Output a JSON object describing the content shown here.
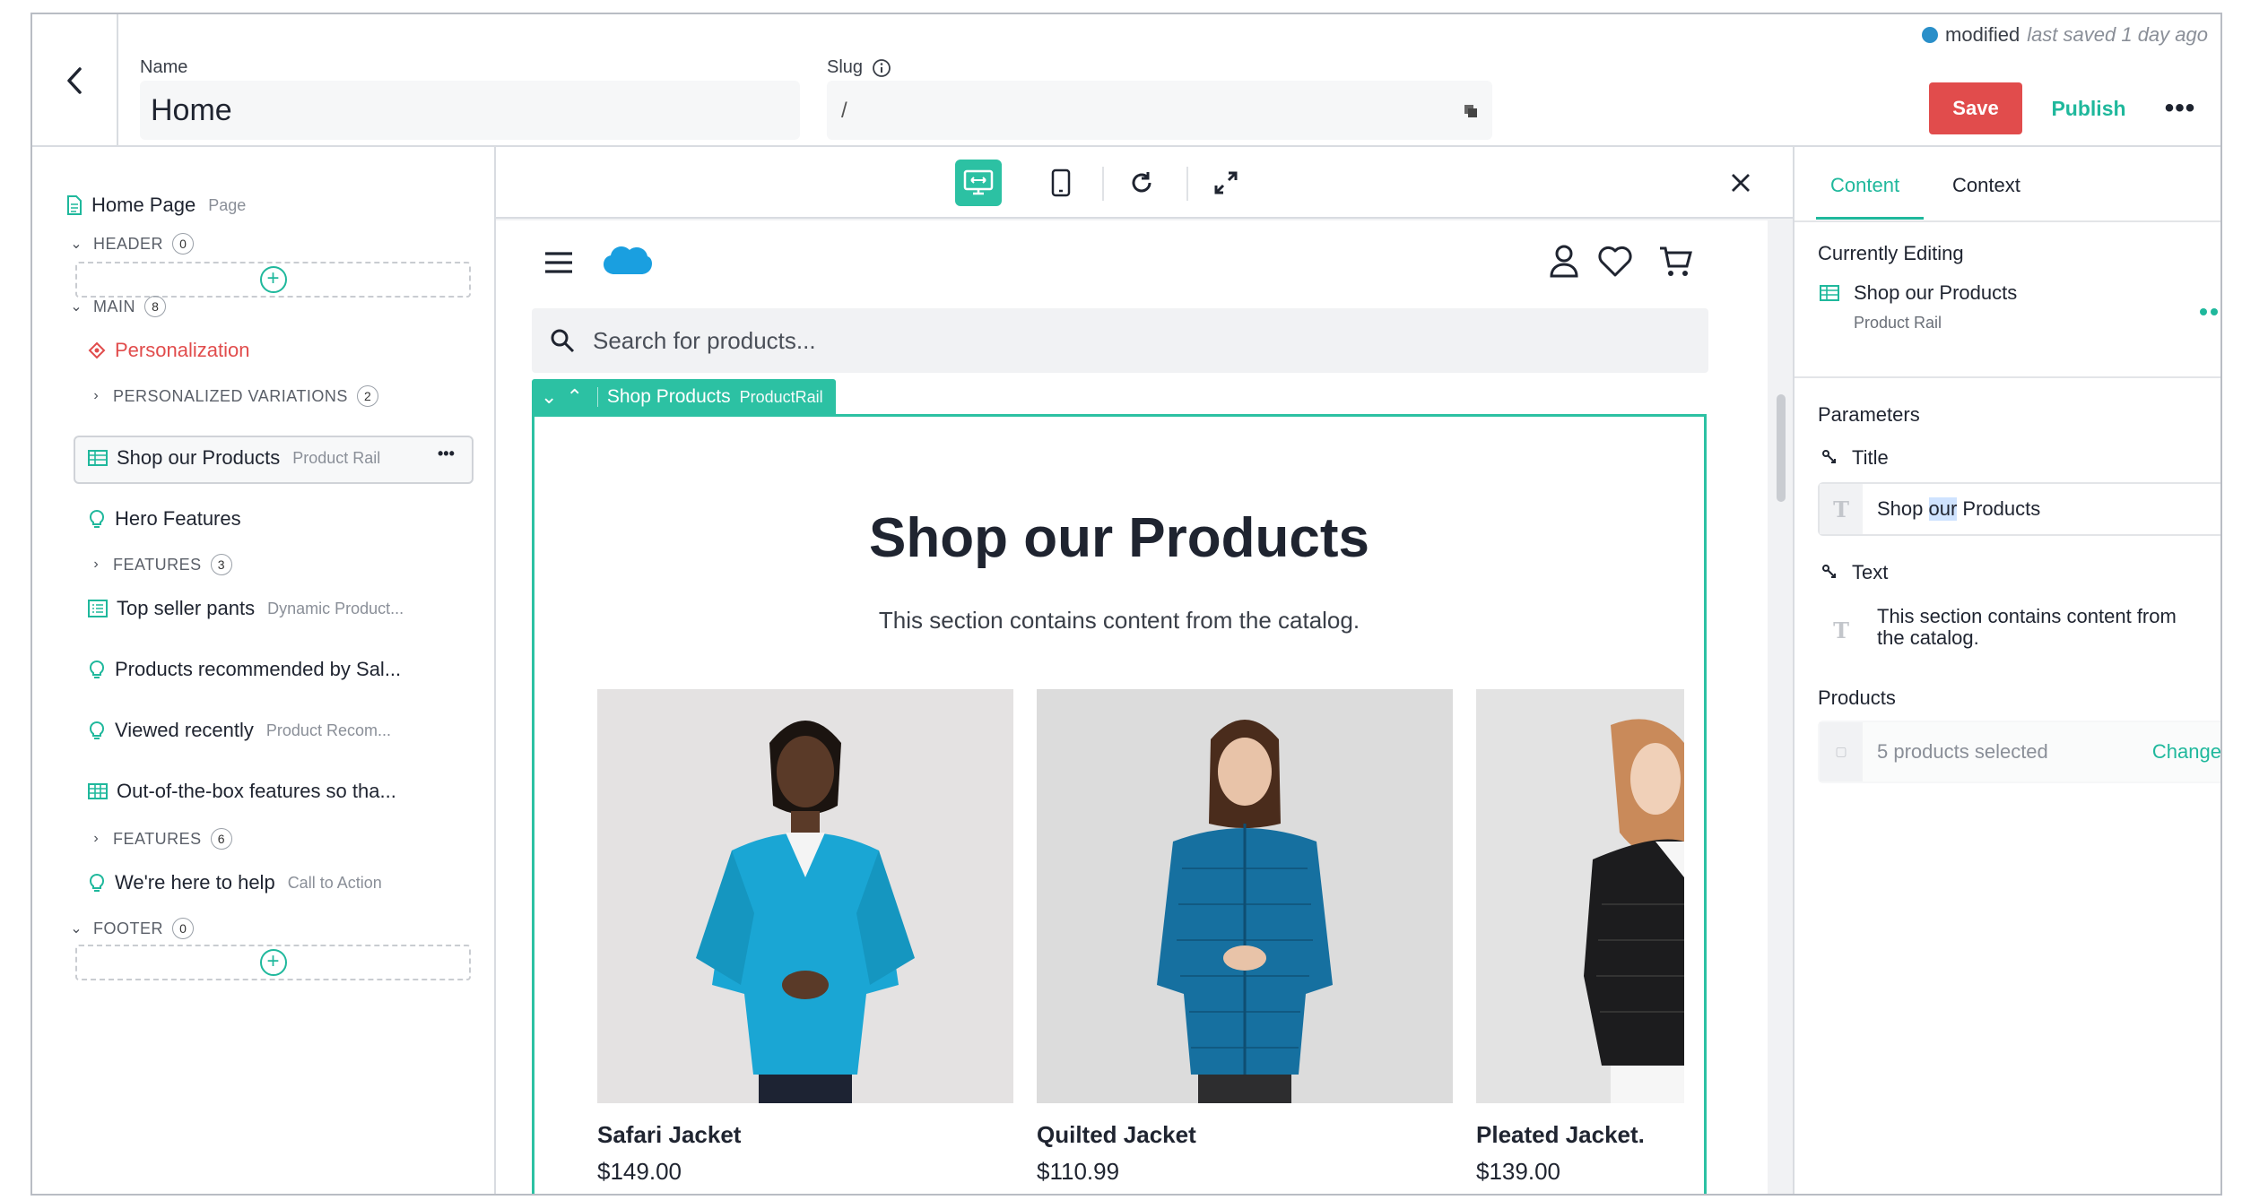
{
  "header": {
    "name_label": "Name",
    "name_value": "Home",
    "slug_label": "Slug",
    "slug_value": "/",
    "status_text": "modified",
    "last_saved": "last saved 1 day ago",
    "save_label": "Save",
    "publish_label": "Publish",
    "more_label": "•••"
  },
  "tree": {
    "root_label": "Home Page",
    "root_type": "Page",
    "header_label": "HEADER",
    "header_count": "0",
    "main_label": "MAIN",
    "main_count": "8",
    "personalization": "Personalization",
    "personalized_variations": "PERSONALIZED VARIATIONS",
    "personalized_count": "2",
    "shop_label": "Shop our Products",
    "shop_type": "Product Rail",
    "shop_more": "•••",
    "hero_label": "Hero Features",
    "features1_label": "FEATURES",
    "features1_count": "3",
    "top_seller_label": "Top seller pants",
    "top_seller_type": "Dynamic Product...",
    "recommended_label": "Products recommended by Sal...",
    "viewed_label": "Viewed recently",
    "viewed_type": "Product Recom...",
    "ootb_label": "Out-of-the-box features so tha...",
    "features2_label": "FEATURES",
    "features2_count": "6",
    "help_label": "We're here to help",
    "help_type": "Call to Action",
    "footer_label": "FOOTER",
    "footer_count": "0"
  },
  "preview": {
    "search_placeholder": "Search for products...",
    "block_name": "Shop Products",
    "block_type": "ProductRail",
    "rail_title": "Shop our Products",
    "rail_text": "This section contains content from the catalog.",
    "products": [
      {
        "name": "Safari Jacket",
        "price": "$149.00",
        "color": "#1aa6d4"
      },
      {
        "name": "Quilted Jacket",
        "price": "$110.99",
        "color": "#1670a0"
      },
      {
        "name": "Pleated Jacket.",
        "price": "$139.00",
        "color": "#1c1c1e"
      }
    ]
  },
  "panel": {
    "tab_content": "Content",
    "tab_context": "Context",
    "currently_editing": "Currently Editing",
    "editing_name": "Shop our Products",
    "editing_type": "Product Rail",
    "parameters": "Parameters",
    "title_label": "Title",
    "title_pre": "Shop ",
    "title_hl": "our",
    "title_post": " Products",
    "text_label": "Text",
    "text_value": "This section contains content from the catalog.",
    "products_label": "Products",
    "products_value": "5 products selected",
    "change_label": "Change"
  },
  "colors": {
    "accent": "#1fb89c",
    "save": "#e14c4c",
    "status_dot": "#2a8fc9",
    "personalization": "#e14c4c"
  }
}
